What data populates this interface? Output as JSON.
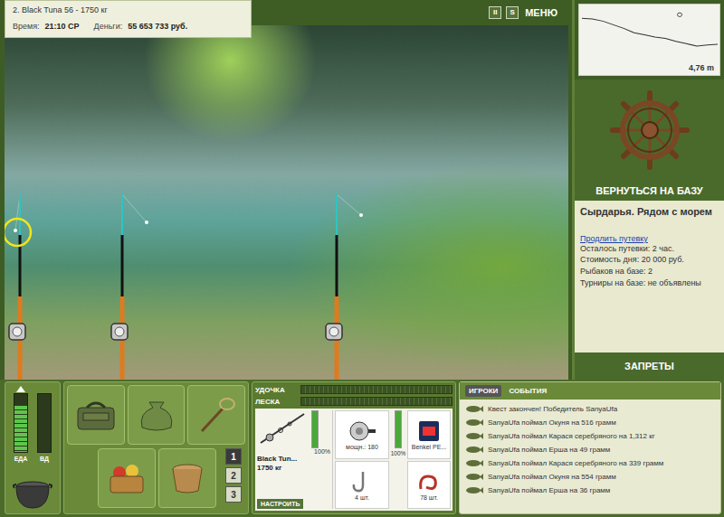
{
  "header": {
    "title": "2. Black Tuna 56 - 1750 кг",
    "time_label": "Время:",
    "time": "21:10 СР",
    "money_label": "Деньги:",
    "money": "55 653 733 руб."
  },
  "toolbar": [
    {
      "label": "II"
    },
    {
      "label": "S"
    },
    {
      "label": "МЕНЮ"
    }
  ],
  "rods": [
    {
      "selected": true
    },
    {
      "selected": false
    },
    {
      "selected": false
    }
  ],
  "depth_map": {
    "depth": "4,76 m",
    "profile": [
      0.9,
      1.0,
      1.3,
      1.8,
      2.3,
      2.9,
      3.2,
      3.5,
      3.7,
      4.1,
      4.4,
      4.76,
      4.6,
      4.5
    ],
    "level": 0.72
  },
  "sidebar": {
    "return_button": "ВЕРНУТЬСЯ НА БАЗУ",
    "location": "Сырдарья. Рядом с морем",
    "extend_link": "Продлить путевку",
    "info": [
      "Осталось путевки: 2 час.",
      "Стоимость дня: 20 000 руб.",
      "Рыбаков на базе: 2",
      "Турниры на базе: не объявлены"
    ],
    "bans_button": "ЗАПРЕТЫ"
  },
  "needs": [
    {
      "label": "ЕДА",
      "level": 0.8
    },
    {
      "label": "ВД",
      "level": 0
    }
  ],
  "slot_buttons": [
    {
      "label": "1",
      "selected": true
    },
    {
      "label": "2",
      "selected": false
    },
    {
      "label": "3",
      "selected": false
    }
  ],
  "tension": [
    {
      "label": "УДОЧКА",
      "level": 0
    },
    {
      "label": "ЛЕСКА",
      "level": 0
    }
  ],
  "tackle": {
    "rod": {
      "name": "Black Tun...",
      "weight": "1750 кг",
      "condition": "100%",
      "level": 1
    },
    "configure": "НАСТРОИТЬ",
    "reel": {
      "power": "мощн.: 180",
      "condition": "100%",
      "level": 1
    },
    "line": {
      "name": "Benkei PE..."
    },
    "hook": {
      "count": "4 шт."
    },
    "bait": {
      "count": "78 шт."
    }
  },
  "chat": {
    "tabs": [
      {
        "label": "ИГРОКИ",
        "selected": true
      },
      {
        "label": "СОБЫТИЯ",
        "selected": false
      }
    ],
    "messages": [
      "Квест закончен! Победитель SanyaUfa",
      "SanyaUfa поймал Окуня на 516 грамм",
      "SanyaUfa поймал Карася серебряного на 1,312 кг",
      "SanyaUfa поймал Ерша на 49 грамм",
      "SanyaUfa поймал Карася серебряного на 339 грамм",
      "SanyaUfa поймал Окуня на 554 грамм",
      "SanyaUfa поймал Ерша на 36 грамм"
    ]
  }
}
